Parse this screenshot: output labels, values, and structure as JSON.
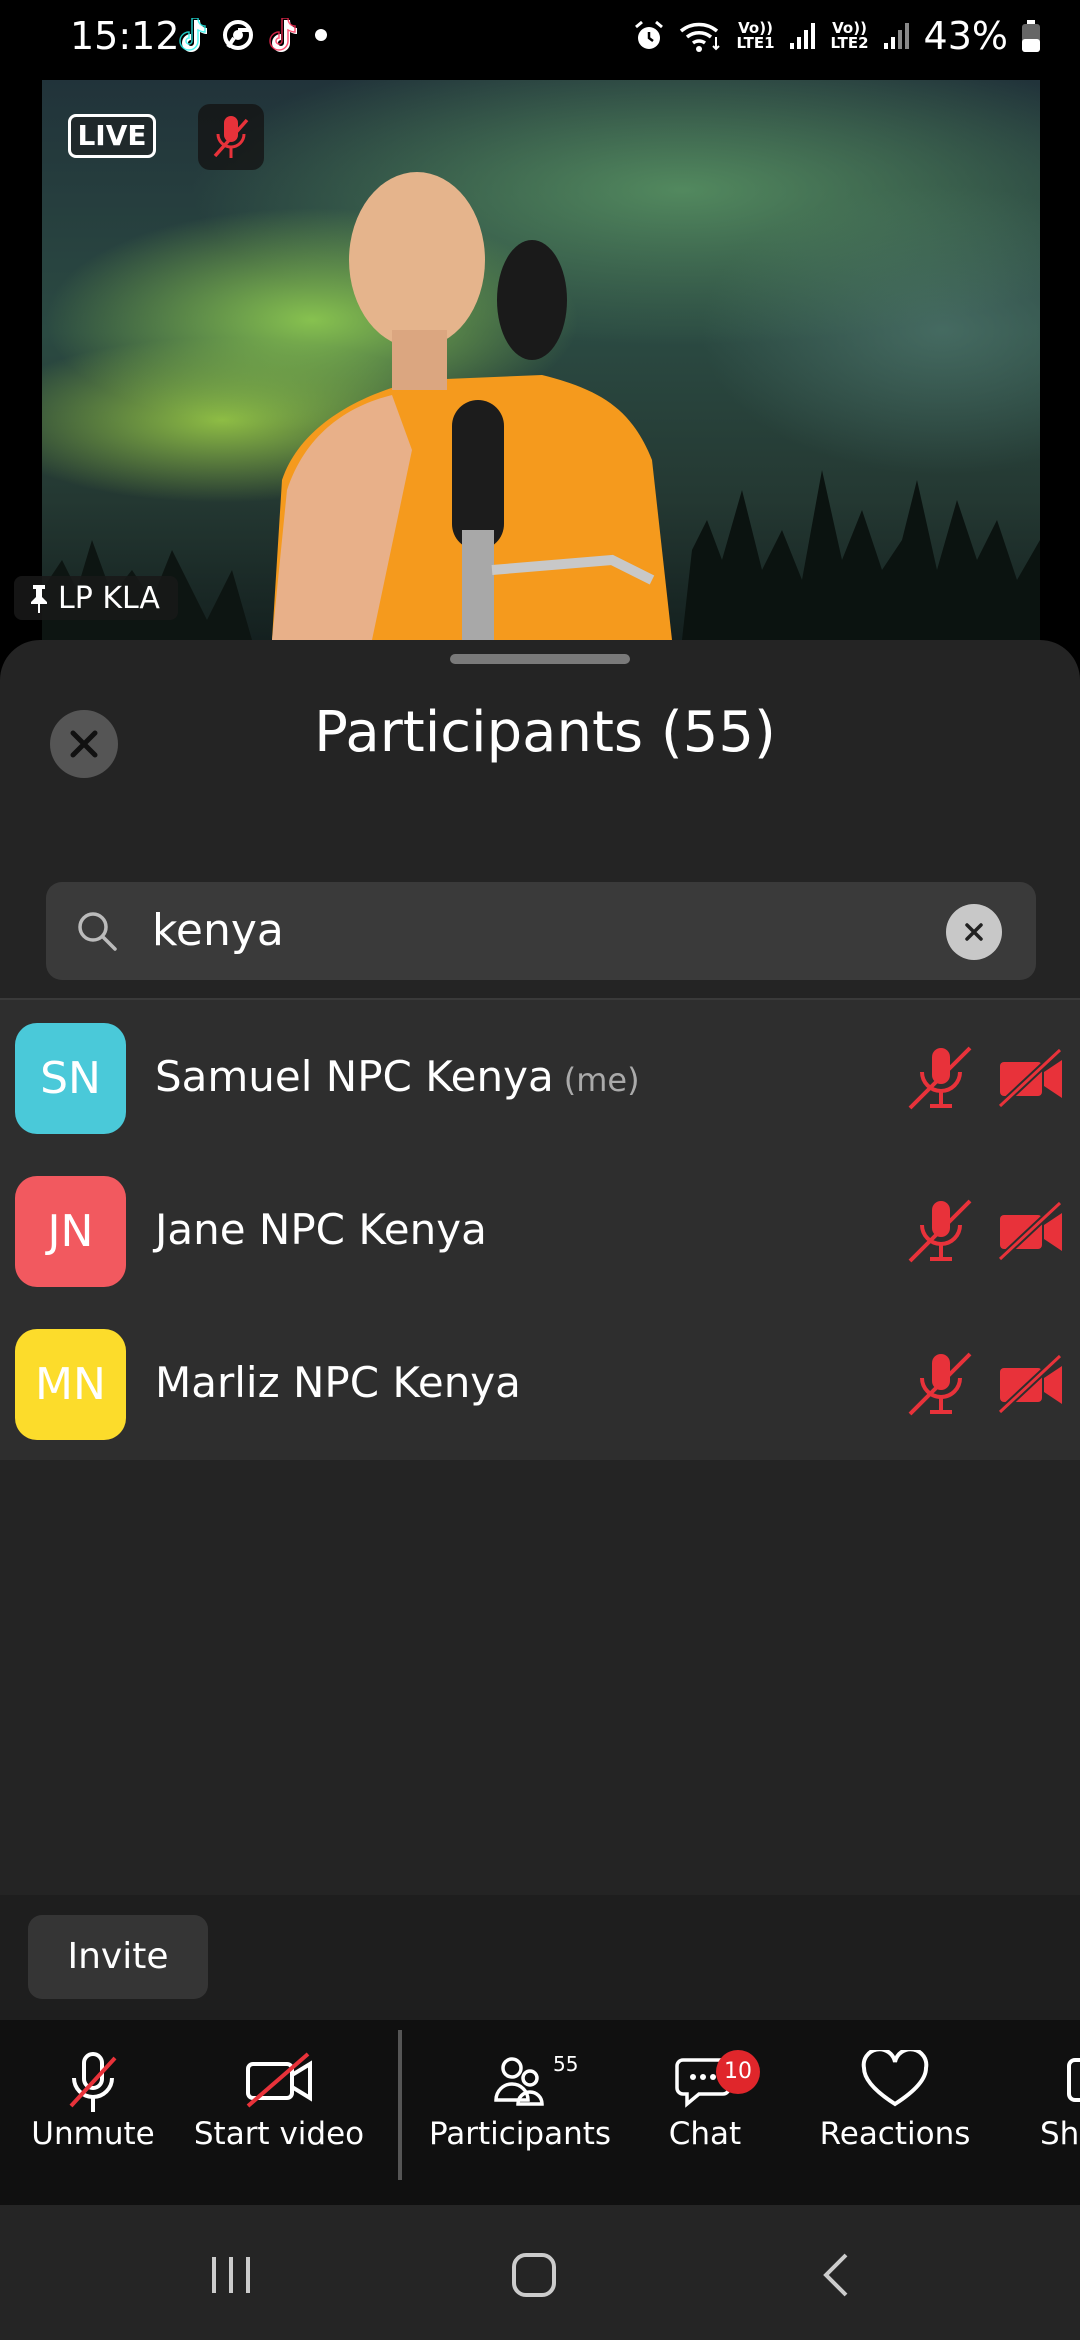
{
  "status_bar": {
    "time": "15:12",
    "battery_percent": "43%",
    "network_1": "Vo)) LTE1",
    "network_2": "Vo)) LTE2",
    "icons": [
      "tiktok-icon",
      "chrome-icon",
      "tiktok-icon",
      "dot-icon",
      "alarm-icon",
      "wifi-icon",
      "signal-icon",
      "battery-icon"
    ]
  },
  "video": {
    "live_label": "LIVE",
    "pinned_name": "LP KLA"
  },
  "participants_panel": {
    "title": "Participants (55)",
    "search": {
      "value": "kenya"
    },
    "participants": [
      {
        "initials": "SN",
        "name": "Samuel NPC Kenya",
        "me_label": "(me)",
        "avatar_color": "#4ac9d9",
        "mic_muted": true,
        "video_off": true
      },
      {
        "initials": "JN",
        "name": "Jane NPC Kenya",
        "me_label": "",
        "avatar_color": "#f2595f",
        "mic_muted": true,
        "video_off": true
      },
      {
        "initials": "MN",
        "name": "Marliz NPC Kenya",
        "me_label": "",
        "avatar_color": "#fcdc2b",
        "mic_muted": true,
        "video_off": true
      }
    ],
    "invite_label": "Invite"
  },
  "toolbar": {
    "unmute_label": "Unmute",
    "start_video_label": "Start video",
    "participants_label": "Participants",
    "participants_count": "55",
    "chat_label": "Chat",
    "chat_badge": "10",
    "reactions_label": "Reactions",
    "share_label": "Sha"
  },
  "colors": {
    "muted_red": "#e8323a",
    "sheet_bg": "#242424",
    "list_bg": "#2e2e2e",
    "toolbar_bg": "#101010"
  }
}
